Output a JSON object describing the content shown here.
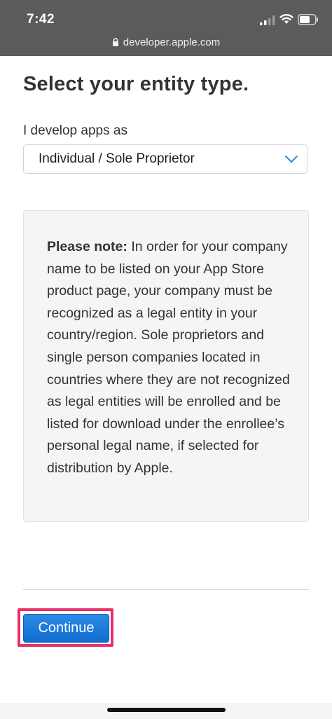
{
  "status_bar": {
    "time": "7:42",
    "background_color": "#5b5b5b",
    "icons": [
      "signal-icon",
      "wifi-icon",
      "battery-icon"
    ]
  },
  "browser": {
    "url": "developer.apple.com",
    "url_icon": "lock-icon"
  },
  "form": {
    "title": "Select your entity type.",
    "select_label": "I develop apps as",
    "select_value": "Individual / Sole Proprietor",
    "select_icon": "chevron-down-icon",
    "accent_color": "#3a8fd6"
  },
  "note": {
    "label": "Please note:",
    "body": "In order for your company name to be listed on your App Store product page, your company must be recognized as a legal entity in your country/region. Sole proprietors and single person companies located in countries where they are not recognized as legal entities will be enrolled and be listed for download under the enrollee’s personal legal name, if selected for distribution by Apple."
  },
  "actions": {
    "continue_label": "Continue",
    "button_color": "#1a78db",
    "highlight_color": "#e8306a"
  }
}
